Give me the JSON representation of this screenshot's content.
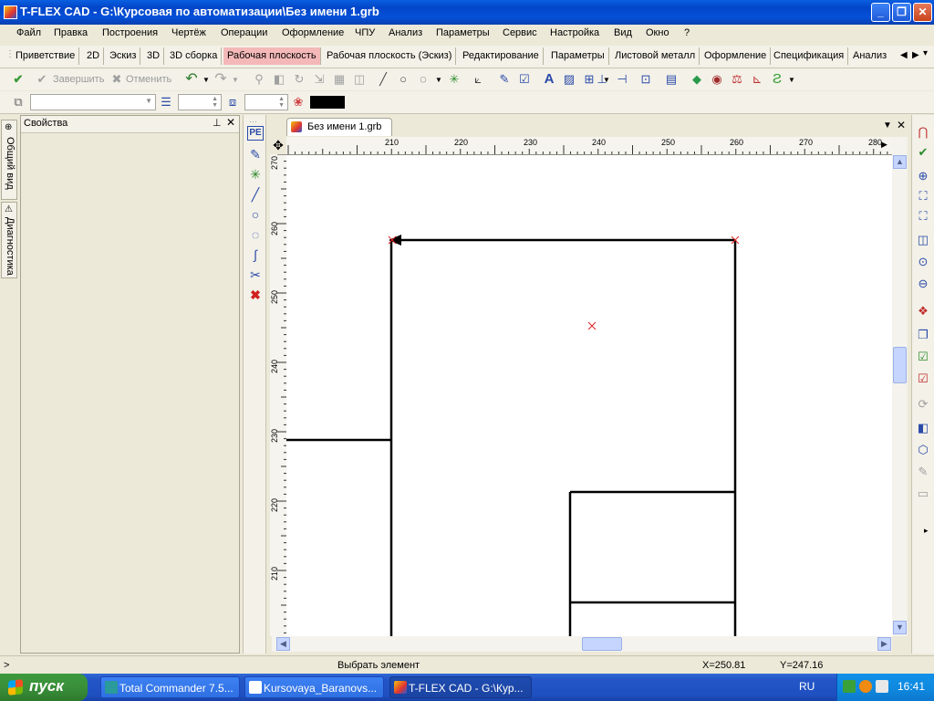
{
  "window": {
    "title": "T-FLEX CAD - G:\\Курсовая по автоматизации\\Без имени 1.grb"
  },
  "menu": [
    "Файл",
    "Правка",
    "Построения",
    "Чертёж",
    "Операции",
    "Оформление",
    "ЧПУ",
    "Анализ",
    "Параметры",
    "Сервис",
    "Настройка",
    "Вид",
    "Окно",
    "?"
  ],
  "ribbon_tabs": [
    {
      "label": "Приветствие",
      "active": false
    },
    {
      "label": "2D",
      "active": false
    },
    {
      "label": "Эскиз",
      "active": false
    },
    {
      "label": "3D",
      "active": false
    },
    {
      "label": "3D сборка",
      "active": false
    },
    {
      "label": "Рабочая плоскость",
      "active": true
    },
    {
      "label": "Рабочая плоскость (Эскиз)",
      "active": false
    },
    {
      "label": "Редактирование",
      "active": false
    },
    {
      "label": "Параметры",
      "active": false
    },
    {
      "label": "Листовой металл",
      "active": false
    },
    {
      "label": "Оформление",
      "active": false
    },
    {
      "label": "Спецификация",
      "active": false
    },
    {
      "label": "Анализ",
      "active": false
    }
  ],
  "toolbar": {
    "finish_label": "Завершить",
    "cancel_label": "Отменить"
  },
  "left_rail": {
    "tab1": "Общий вид",
    "tab2": "Диагностика"
  },
  "properties_panel": {
    "title": "Свойства"
  },
  "document": {
    "tab_label": "Без имени 1.grb",
    "ruler_h_ticks": [
      "210",
      "220",
      "230",
      "240",
      "250",
      "260",
      "270",
      "280"
    ],
    "ruler_v_ticks": [
      "270",
      "260",
      "250",
      "240",
      "230",
      "220",
      "210"
    ]
  },
  "status": {
    "hint": "Выбрать элемент",
    "x_label": "X=250.81",
    "y_label": "Y=247.16",
    "left_marker": ">"
  },
  "taskbar": {
    "start_label": "пуск",
    "tasks": [
      {
        "label": "Total Commander 7.5...",
        "active": false
      },
      {
        "label": "Kursovaya_Baranovs...",
        "active": false
      },
      {
        "label": "T-FLEX CAD - G:\\Кур...",
        "active": true
      }
    ],
    "language": "RU",
    "clock": "16:41"
  },
  "colors": {
    "active_tab": "#f4b8b8",
    "xp_blue": "#0450d8",
    "start_green": "#3a8f3a",
    "construction_mark": "#e02020"
  }
}
